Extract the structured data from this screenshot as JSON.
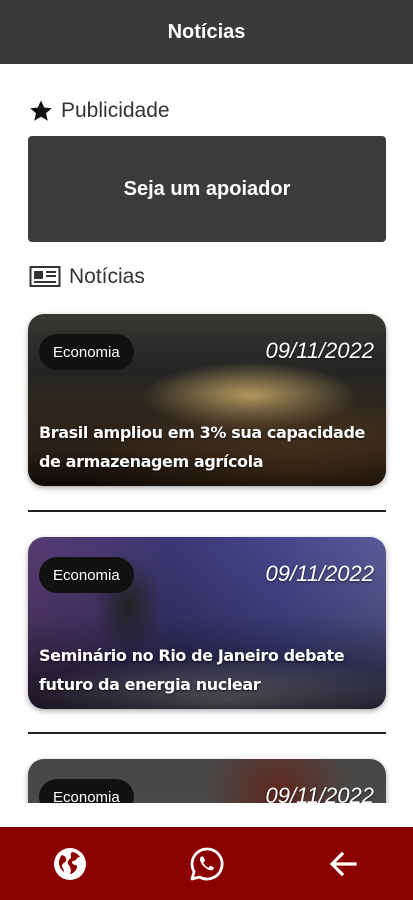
{
  "appbar": {
    "title": "Notícias"
  },
  "ads_section": {
    "title": "Publicidade",
    "banner_label": "Seja um apoiador"
  },
  "news_section": {
    "title": "Notícias"
  },
  "articles": [
    {
      "category": "Economia",
      "date": "09/11/2022",
      "headline": "Brasil ampliou em 3% sua capacidade de armazenagem agrícola"
    },
    {
      "category": "Economia",
      "date": "09/11/2022",
      "headline": "Seminário no Rio de Janeiro debate futuro da energia nuclear"
    },
    {
      "category": "Economia",
      "date": "09/11/2022",
      "headline": ""
    }
  ],
  "bottom_nav": [
    {
      "icon": "globe-icon"
    },
    {
      "icon": "whatsapp-icon"
    },
    {
      "icon": "arrow-left-icon"
    }
  ],
  "colors": {
    "appbar": "#3a3a3a",
    "bottom_bar": "#8b0000",
    "chip": "#111111"
  }
}
